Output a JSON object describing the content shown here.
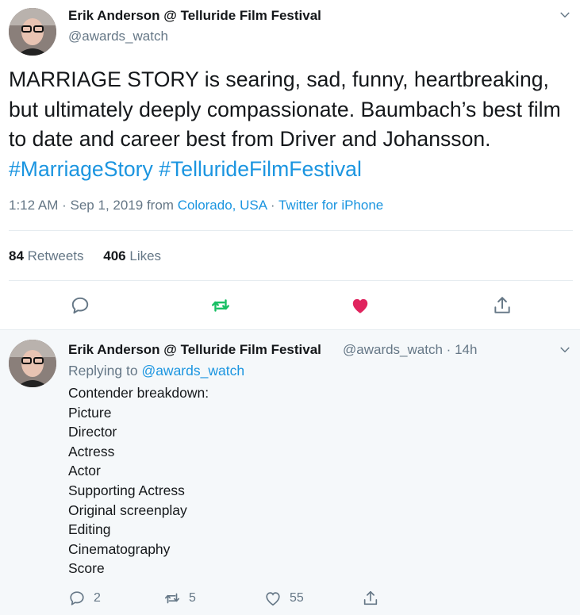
{
  "tweet": {
    "author_name": "Erik Anderson @ Telluride Film Festival",
    "author_handle": "@awards_watch",
    "text_plain": "MARRIAGE STORY is searing, sad, funny, heartbreaking, but ultimately deeply compassionate. Baumbach’s best film to date and career best from Driver and Johansson.",
    "hashtags": [
      "#MarriageStory",
      "#TellurideFilmFestival"
    ],
    "time": "1:12 AM",
    "separator": "·",
    "date": "Sep 1, 2019",
    "from_label": "from",
    "location": "Colorado, USA",
    "source": "Twitter for iPhone",
    "retweets_count": "84",
    "retweets_label": "Retweets",
    "likes_count": "406",
    "likes_label": "Likes"
  },
  "reply": {
    "author_name": "Erik Anderson @ Telluride Film Festival",
    "author_handle": "@awards_watch",
    "time_ago": "14h",
    "separator": "·",
    "replying_to_label": "Replying to",
    "replying_to_handle": "@awards_watch",
    "lines": [
      "Contender breakdown:",
      "Picture",
      "Director",
      "Actress",
      "Actor",
      "Supporting Actress",
      "Original screenplay",
      "Editing",
      "Cinematography",
      "Score"
    ],
    "reply_count": "2",
    "retweet_count": "5",
    "like_count": "55"
  },
  "colors": {
    "link": "#1b95e0",
    "retweet_green": "#17bf63",
    "like_red": "#e0245e",
    "muted": "#657786"
  },
  "icons": [
    "chevron-down-icon",
    "reply-icon",
    "retweet-icon",
    "heart-icon",
    "share-icon"
  ]
}
